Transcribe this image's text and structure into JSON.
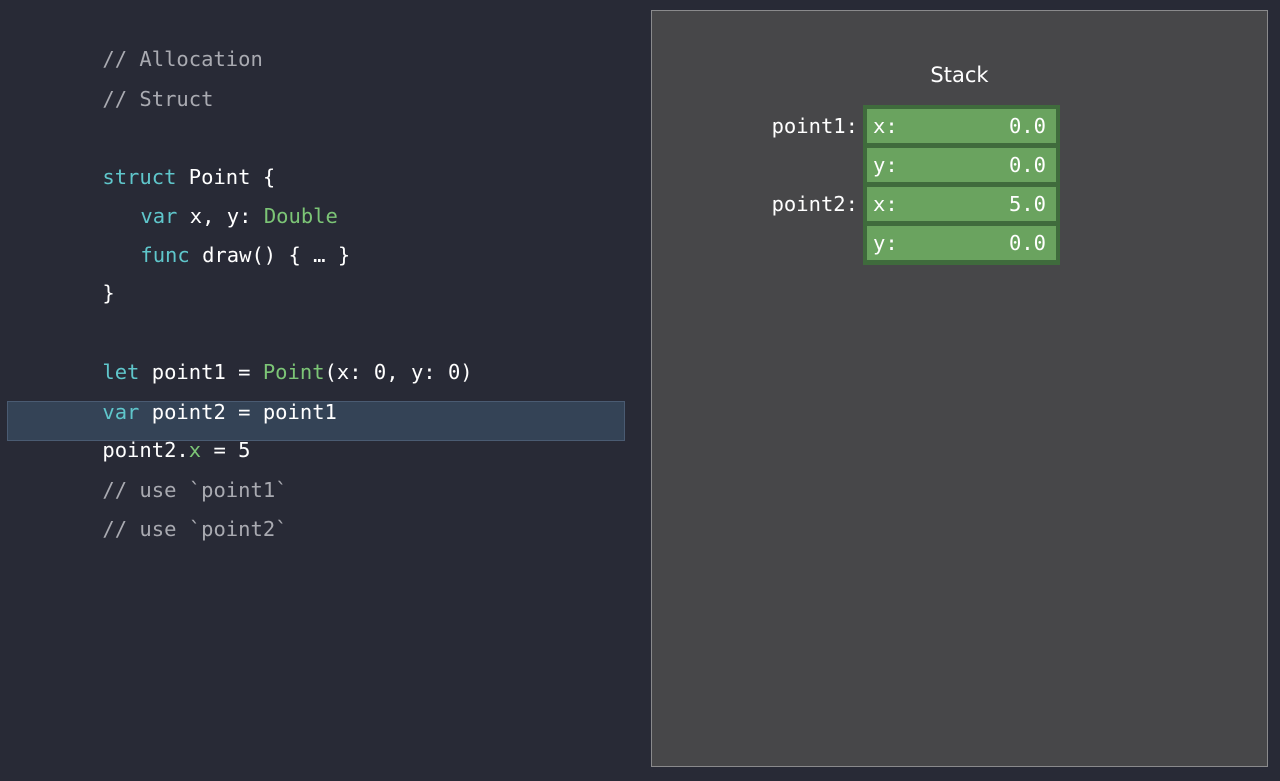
{
  "code": {
    "comment_allocation": "// Allocation",
    "comment_struct": "// Struct",
    "struct_keyword": "struct",
    "struct_name": " Point {",
    "var_keyword": "var",
    "var_decl": " x, y: ",
    "var_type": "Double",
    "func_keyword": "func",
    "func_decl": " draw() { … }",
    "close_brace": "}",
    "let_keyword": "let",
    "let_decl": " point1 = ",
    "let_type": "Point",
    "let_args": "(x: 0, y: 0)",
    "var2_keyword": "var",
    "var2_decl": " point2 = point1",
    "assign_target": "point2.",
    "assign_field": "x",
    "assign_value": " = 5",
    "comment_use1": "// use `point1`",
    "comment_use2": "// use `point2`"
  },
  "stack": {
    "title": "Stack",
    "point1_label": "point1:",
    "point2_label": "point2:",
    "cells": [
      {
        "label": "x:",
        "value": "0.0"
      },
      {
        "label": "y:",
        "value": "0.0"
      },
      {
        "label": "x:",
        "value": "5.0"
      },
      {
        "label": "y:",
        "value": "0.0"
      }
    ]
  },
  "colors": {
    "background": "#282a36",
    "keyword": "#5fc6cb",
    "type": "#7cc576",
    "comment": "#a9aab1",
    "highlight": "#344356",
    "stack_panel": "#474749",
    "stack_cell": "#6aa35f"
  }
}
